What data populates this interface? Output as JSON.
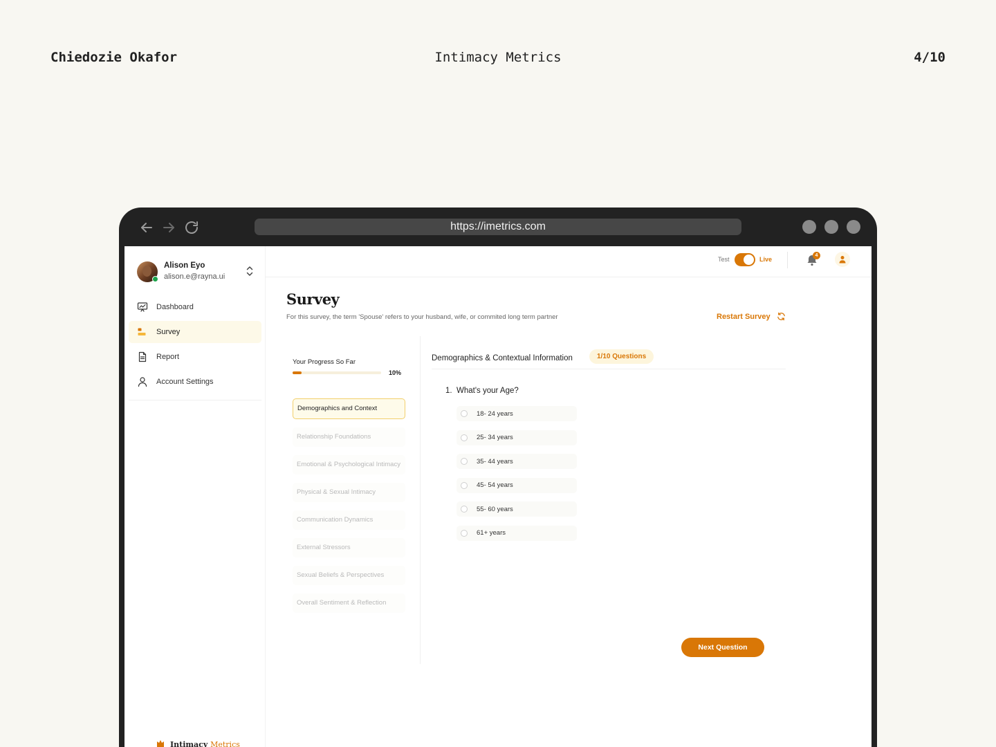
{
  "presentation": {
    "author": "Chiedozie Okafor",
    "title": "Intimacy Metrics",
    "page": "4/10"
  },
  "browser": {
    "url": "https://imetrics.com",
    "icons": [
      "back-arrow-icon",
      "forward-arrow-icon",
      "reload-icon"
    ]
  },
  "user": {
    "name": "Alison Eyo",
    "email": "alison.e@rayna.ui",
    "status_color": "#1aa34a"
  },
  "sidebar": {
    "items": [
      {
        "label": "Dashboard",
        "icon": "presentation-chart-icon",
        "active": false
      },
      {
        "label": "Survey",
        "icon": "survey-bars-icon",
        "active": true
      },
      {
        "label": "Report",
        "icon": "document-icon",
        "active": false
      },
      {
        "label": "Account Settings",
        "icon": "user-icon",
        "active": false
      }
    ],
    "brand_name": "Intimacy",
    "brand_accent": "Metrics"
  },
  "topbar": {
    "mode_off_label": "Test",
    "mode_on_label": "Live",
    "mode_is_live": true,
    "notification_count": "4"
  },
  "main": {
    "title": "Survey",
    "subtitle": "For this survey, the term 'Spouse' refers to your husband, wife, or commited long term partner",
    "restart_label": "Restart Survey"
  },
  "progress": {
    "label": "Your Progress So Far",
    "percent_label": "10%",
    "value": 0.1
  },
  "sections": [
    {
      "label": "Demographics and Context",
      "active": true
    },
    {
      "label": "Relationship Foundations",
      "active": false
    },
    {
      "label": "Emotional & Psychological Intimacy",
      "active": false
    },
    {
      "label": "Physical & Sexual Intimacy",
      "active": false
    },
    {
      "label": "Communication Dynamics",
      "active": false
    },
    {
      "label": "External Stressors",
      "active": false
    },
    {
      "label": "Sexual Beliefs & Perspectives",
      "active": false
    },
    {
      "label": "Overall Sentiment & Reflection",
      "active": false
    }
  ],
  "question_panel": {
    "section_name": "Demographics & Contextual Information",
    "count_label": "1/10 Questions",
    "question_number": "1.",
    "question": "What's your Age?",
    "options": [
      "18- 24 years",
      "25- 34 years",
      "35- 44 years",
      "45- 54 years",
      "55- 60 years",
      "61+ years"
    ],
    "next_label": "Next Question"
  },
  "colors": {
    "accent": "#d97706",
    "background": "#f8f7f2",
    "device_frame": "#222222"
  }
}
